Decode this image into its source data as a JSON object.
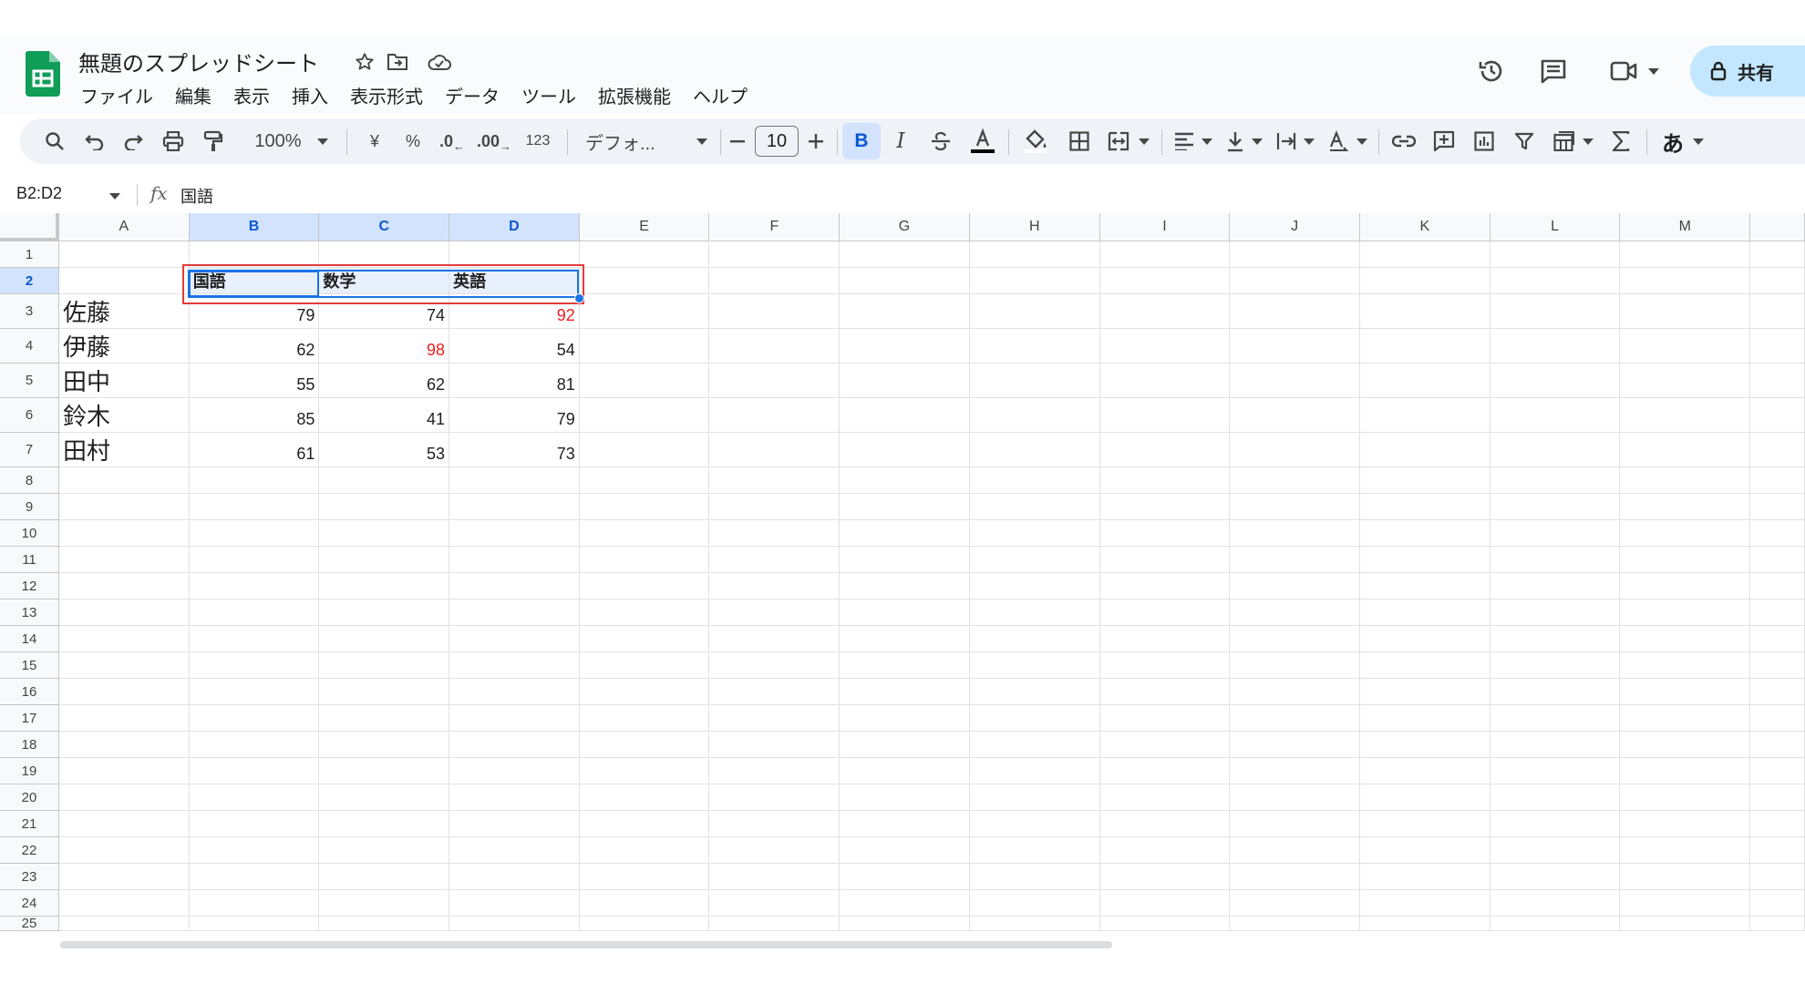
{
  "doc": {
    "title": "無題のスプレッドシート"
  },
  "menus": [
    "ファイル",
    "編集",
    "表示",
    "挿入",
    "表示形式",
    "データ",
    "ツール",
    "拡張機能",
    "ヘルプ"
  ],
  "share_label": "共有",
  "toolbar": {
    "zoom": "100%",
    "currency": "¥",
    "percent": "%",
    "dec_decrease": ".0",
    "dec_increase": ".00",
    "number_format": "123",
    "font": "デフォ...",
    "font_size": "10",
    "bold": "B",
    "italic": "I",
    "input_tools": "あ"
  },
  "formula_bar": {
    "name_box": "B2:D2",
    "fx": "fx",
    "content": "国語"
  },
  "columns": [
    "A",
    "B",
    "C",
    "D",
    "E",
    "F",
    "G",
    "H",
    "I",
    "J",
    "K",
    "L",
    "M"
  ],
  "rows": [
    "1",
    "2",
    "3",
    "4",
    "5",
    "6",
    "7",
    "8",
    "9",
    "10",
    "11",
    "12",
    "13",
    "14",
    "15",
    "16",
    "17",
    "18",
    "19",
    "20",
    "21",
    "22",
    "23",
    "24",
    "25"
  ],
  "headers": [
    "国語",
    "数学",
    "英語"
  ],
  "students": [
    {
      "name": "佐藤",
      "scores": [
        "79",
        "74",
        "92"
      ]
    },
    {
      "name": "伊藤",
      "scores": [
        "62",
        "98",
        "54"
      ]
    },
    {
      "name": "田中",
      "scores": [
        "55",
        "62",
        "81"
      ]
    },
    {
      "name": "鈴木",
      "scores": [
        "85",
        "41",
        "79"
      ]
    },
    {
      "name": "田村",
      "scores": [
        "61",
        "53",
        "73"
      ]
    }
  ],
  "colors": {
    "highlight_score": "#ea1d1d",
    "selection": "#1a73e8",
    "annotation_box": "#e23b3b",
    "share_bg": "#c2e7ff"
  }
}
